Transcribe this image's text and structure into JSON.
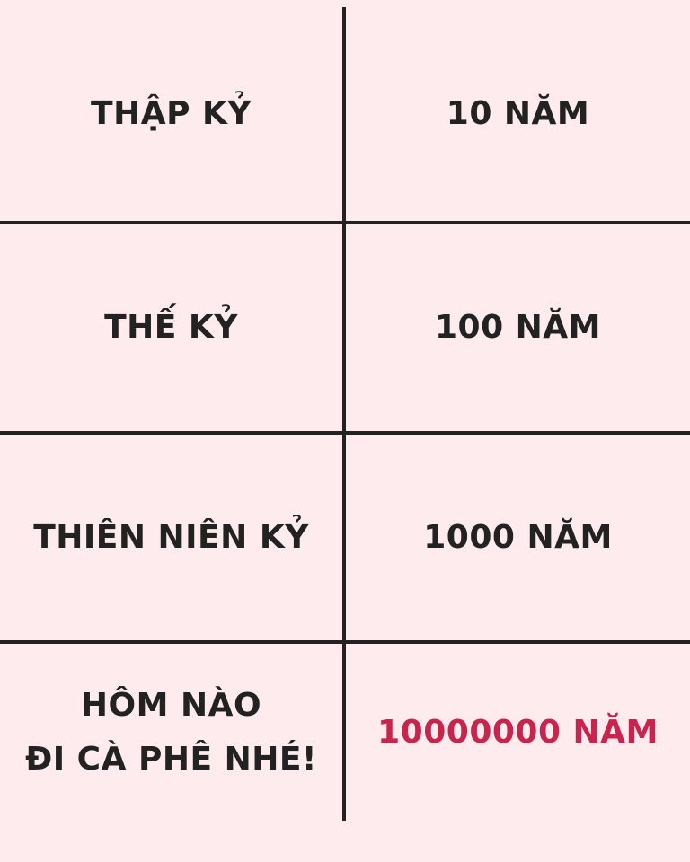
{
  "rows": [
    {
      "term": "THẬP KỶ",
      "value": "10 NĂM"
    },
    {
      "term": "THẾ KỶ",
      "value": "100 NĂM"
    },
    {
      "term": "THIÊN NIÊN KỶ",
      "value": "1000 NĂM"
    },
    {
      "term_line1": "HÔM NÀO",
      "term_line2": "ĐI CÀ PHÊ NHÉ!",
      "value": "10000000 NĂM"
    }
  ],
  "colors": {
    "background": "#fdebee",
    "text": "#222222",
    "accent": "#c7254e",
    "lines": "#222222"
  }
}
